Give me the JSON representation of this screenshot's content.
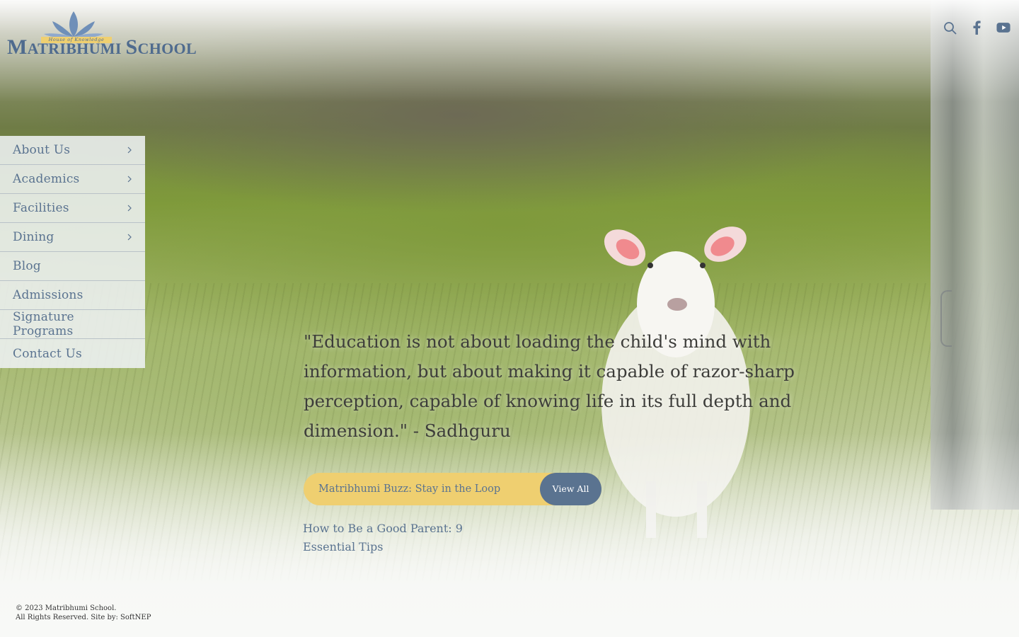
{
  "brand": {
    "name_first_initial": "M",
    "name_first_rest": "ATRIBHUMI ",
    "name_second_initial": "S",
    "name_second_rest": "CHOOL",
    "tagline": "House of Knowledge",
    "colors": {
      "primary": "#5a7390",
      "accent": "#efcf70"
    }
  },
  "header_icons": [
    "search-icon",
    "facebook-icon",
    "youtube-icon"
  ],
  "menu": {
    "items": [
      {
        "label": "About Us",
        "has_submenu": true
      },
      {
        "label": "Academics",
        "has_submenu": true
      },
      {
        "label": "Facilities",
        "has_submenu": true
      },
      {
        "label": "Dining",
        "has_submenu": true
      },
      {
        "label": "Blog",
        "has_submenu": false
      },
      {
        "label": "Admissions",
        "has_submenu": false
      },
      {
        "label": "Signature Programs",
        "has_submenu": false
      },
      {
        "label": "Contact Us",
        "has_submenu": false
      }
    ]
  },
  "hero": {
    "quote": "\"Education is not about loading the child's mind with information, but about making it capable of razor-sharp perception, capable of knowing life in its full depth and dimension.\" - Sadhguru"
  },
  "news": {
    "heading": "Matribhumi Buzz: Stay in the Loop",
    "view_all_label": "View All",
    "latest_post": "How to Be a Good Parent: 9 Essential Tips"
  },
  "footer": {
    "copyright": "© 2023 Matribhumi School.",
    "credits": "All Rights Reserved. Site by: SoftNEP"
  }
}
